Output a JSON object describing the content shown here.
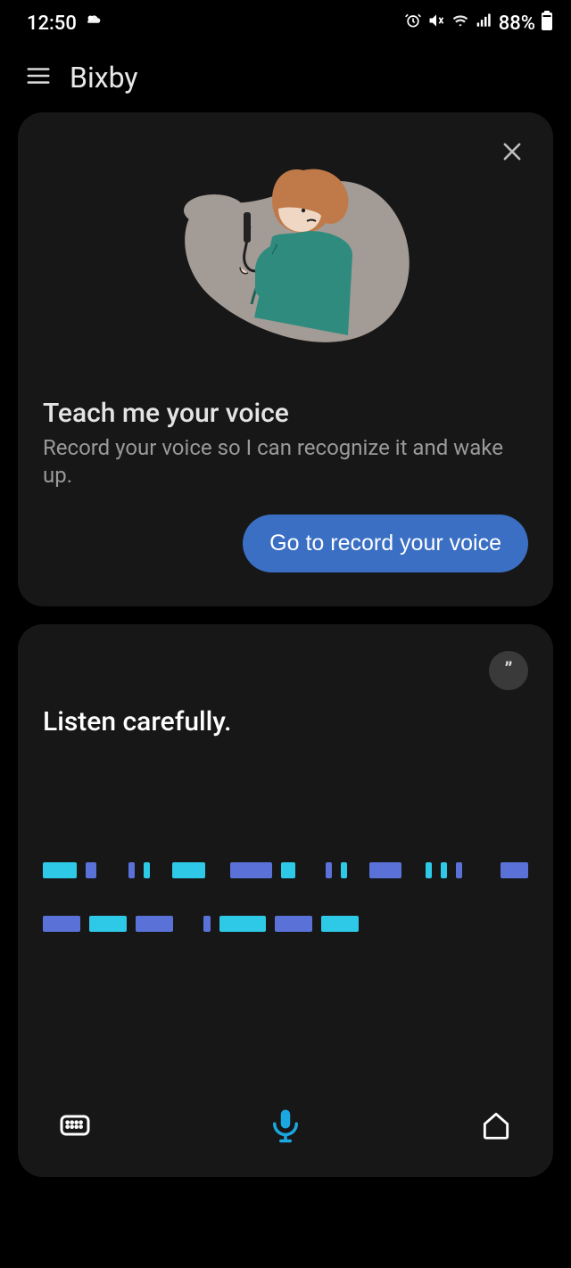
{
  "status": {
    "time": "12:50",
    "battery": "88%"
  },
  "header": {
    "title": "Bixby"
  },
  "teach_card": {
    "title": "Teach me your voice",
    "description": "Record your voice so I can recognize it and wake up.",
    "button_label": "Go to record your voice"
  },
  "listen_card": {
    "title": "Listen carefully."
  },
  "colors": {
    "accent_blue": "#3a6fc4",
    "stream_cyan": "#2ec9e6",
    "stream_blue": "#5a72d8"
  },
  "icons": {
    "menu": "menu-icon",
    "weather": "weather-icon",
    "alarm": "alarm-icon",
    "mute": "mute-icon",
    "wifi": "wifi-icon",
    "signal": "signal-icon",
    "battery": "battery-icon",
    "close": "close-icon",
    "quote": "quote-icon",
    "keyboard": "keyboard-icon",
    "mic": "mic-icon",
    "home": "home-icon"
  }
}
